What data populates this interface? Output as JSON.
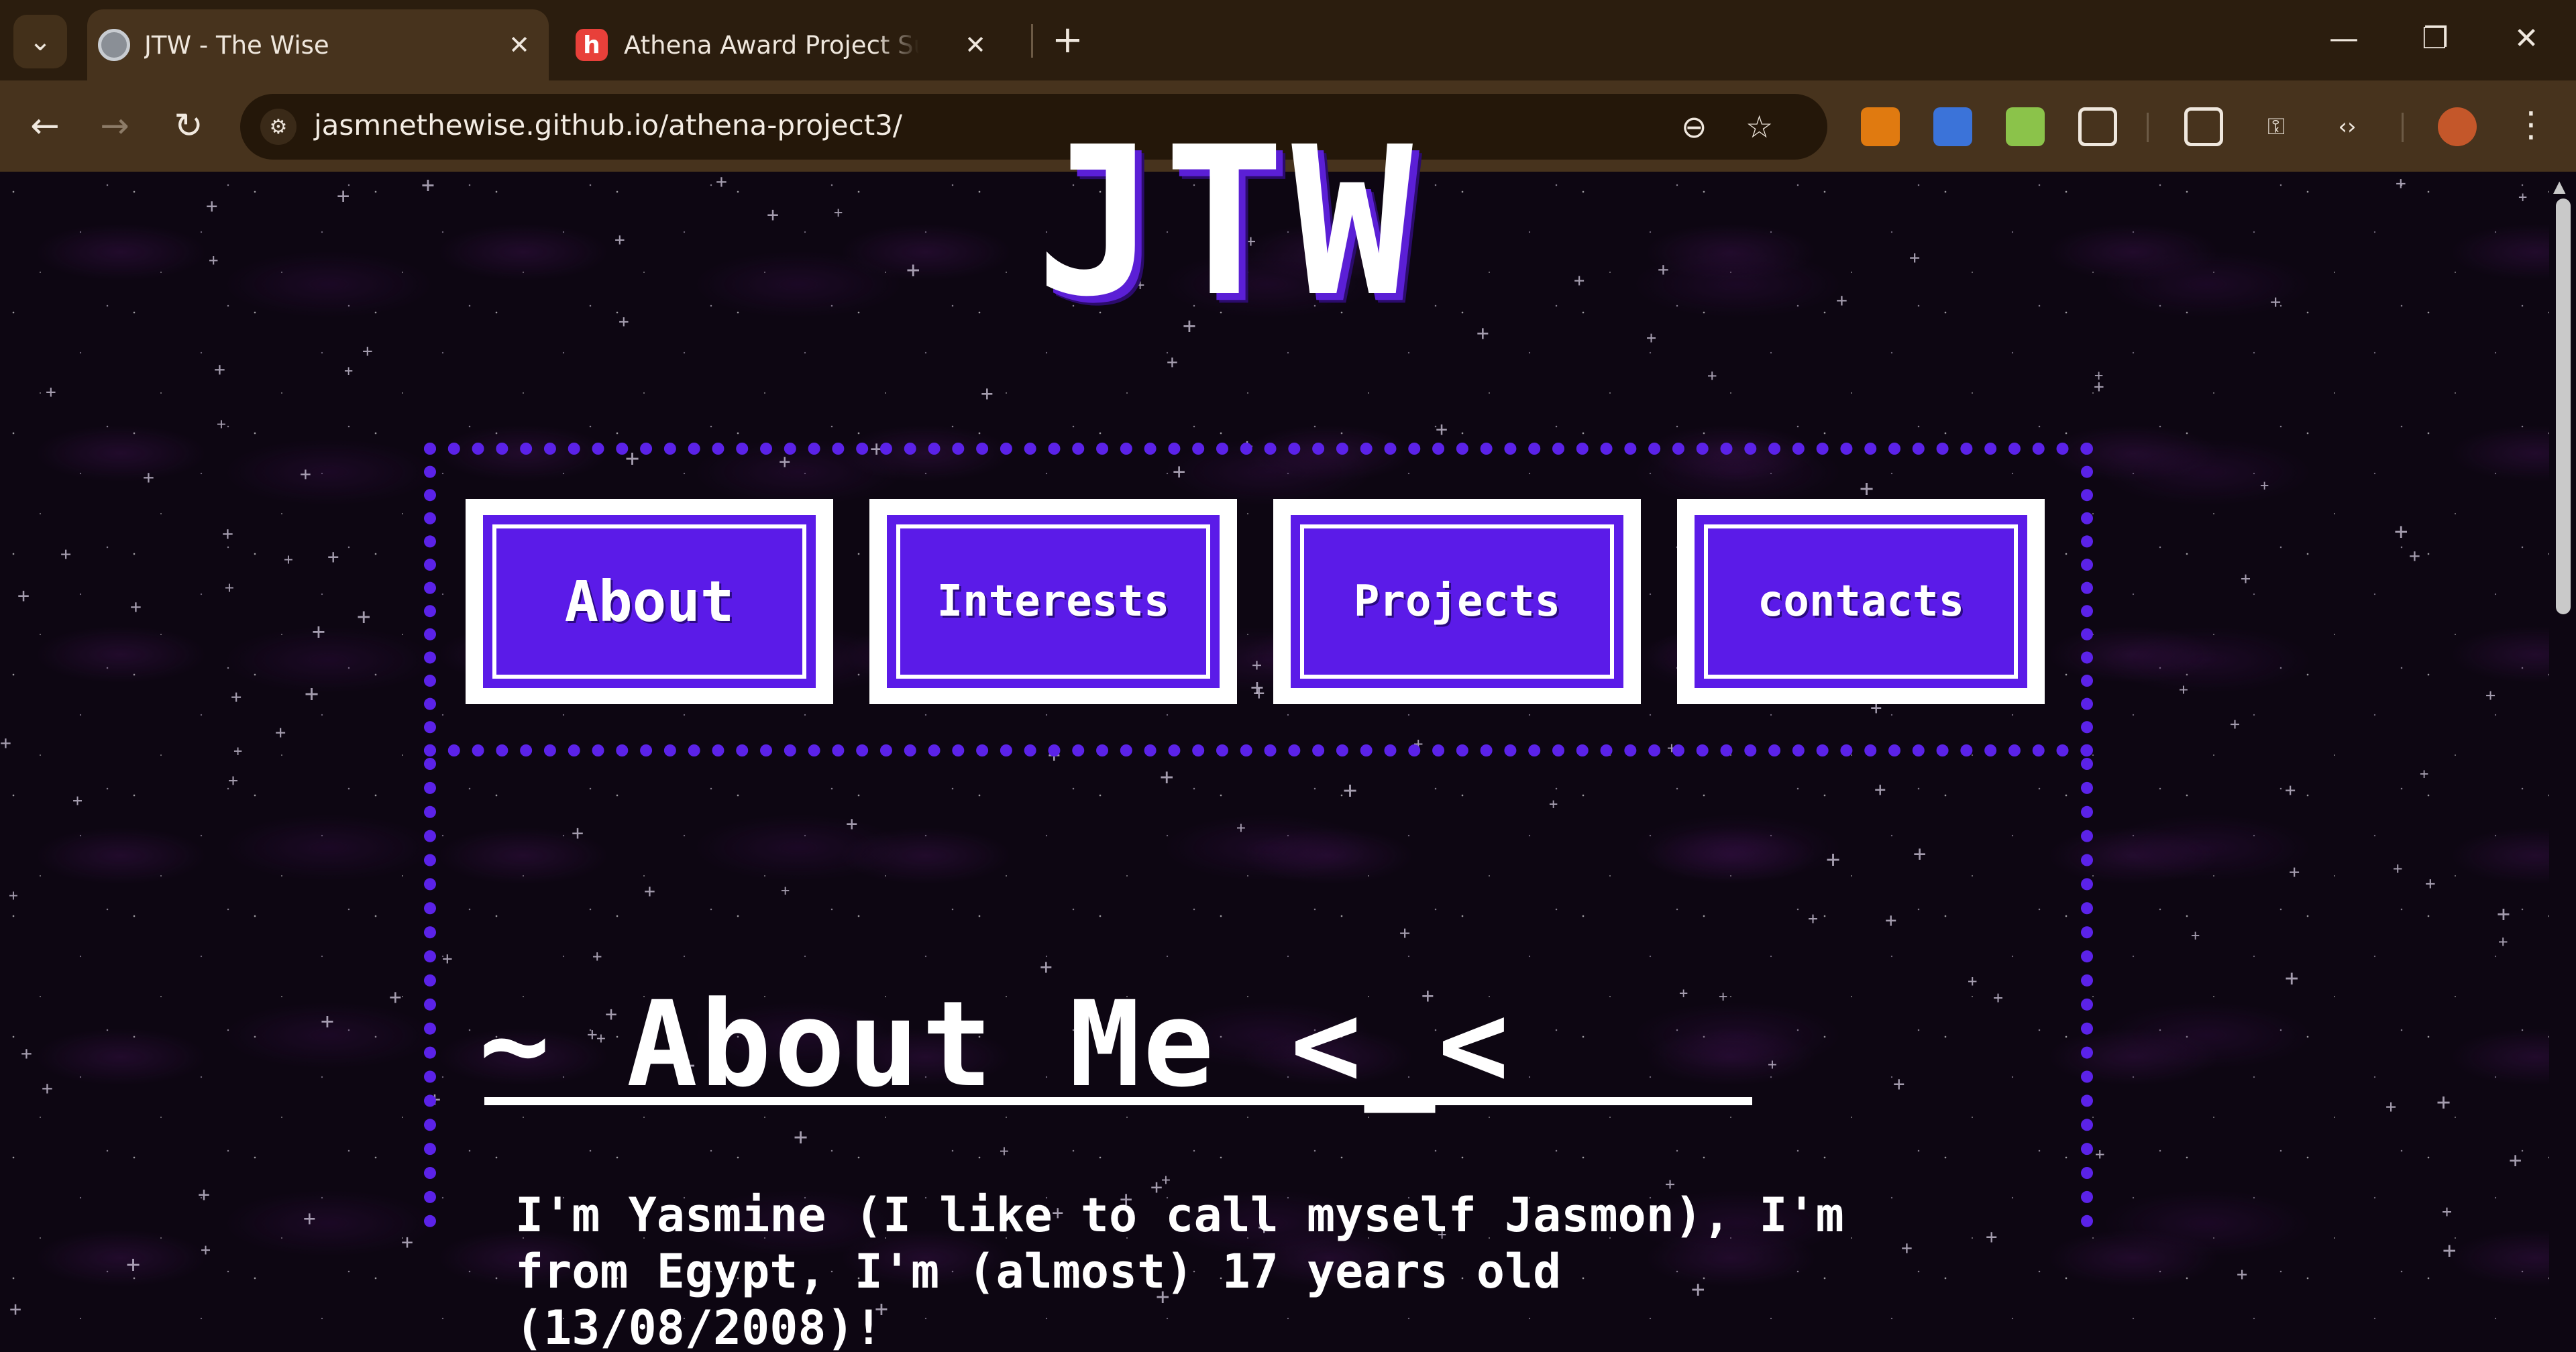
{
  "browser": {
    "tabs": [
      {
        "title": "JTW - The Wise",
        "favicon": "globe-icon",
        "active": true
      },
      {
        "title": "Athena Award Project Submission",
        "favicon": "h-logo-icon",
        "active": false
      }
    ],
    "url": "jasmnethewise.github.io/athena-project3/",
    "icons": {
      "tab_list": "⌄",
      "close": "✕",
      "new_tab": "+",
      "minimize": "—",
      "restore": "❐",
      "close_window": "✕",
      "back": "←",
      "forward": "→",
      "reload": "↻",
      "zoom": "⊖",
      "bookmark": "☆",
      "menu": "⋮",
      "code": "‹›",
      "key": "⚿",
      "site_info": "⚙",
      "h_favicon": "h"
    },
    "colors": {
      "tabbar": "#2b1d0e",
      "toolbar": "#47331d",
      "accent": "#5b1be8"
    }
  },
  "page": {
    "logo": "JTW",
    "nav": [
      {
        "label": "About"
      },
      {
        "label": "Interests"
      },
      {
        "label": "Projects"
      },
      {
        "label": "contacts"
      }
    ],
    "about": {
      "heading": "~ About Me <_<",
      "text": "I'm Yasmine (I like to call myself Jasmon), I'm from Egypt, I'm (almost) 17 years old (13/08/2008)!"
    }
  }
}
